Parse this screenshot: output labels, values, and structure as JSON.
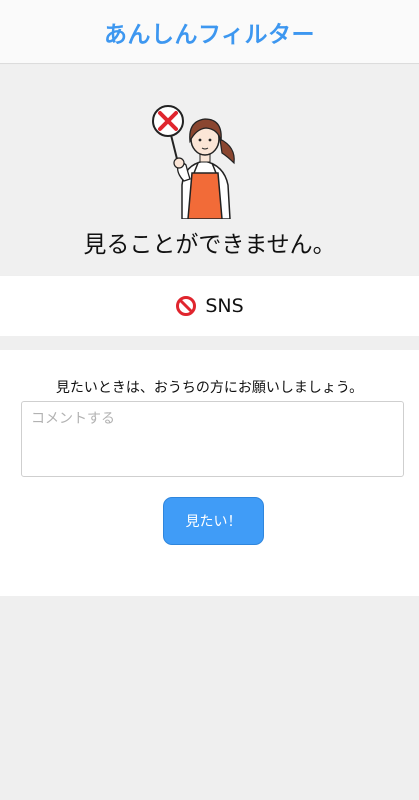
{
  "header": {
    "app_title": "あんしんフィルター"
  },
  "hero": {
    "message": "見ることができません。"
  },
  "category": {
    "label": "SNS",
    "icon": "prohibited-icon"
  },
  "request": {
    "instruction": "見たいときは、おうちの方にお願いしましょう。",
    "comment_placeholder": "コメントする",
    "comment_value": "",
    "submit_label": "見たい！"
  },
  "colors": {
    "accent": "#3d97f0",
    "button": "#409cf7",
    "prohibited": "#e0252e",
    "apron": "#f26b38"
  }
}
